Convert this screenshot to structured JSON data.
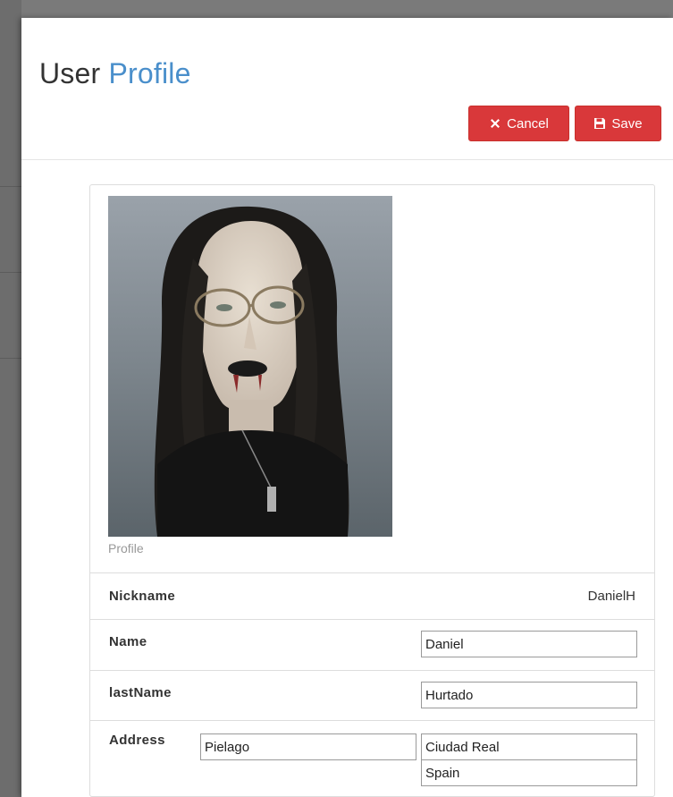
{
  "modal": {
    "title_plain": "User",
    "title_accent": "Profile"
  },
  "toolbar": {
    "cancel_label": "Cancel",
    "save_label": "Save"
  },
  "colors": {
    "title_accent": "#4a8fcb",
    "button_danger": "#d9383a"
  },
  "icons": {
    "cancel": "close-icon",
    "save": "floppy-disk-icon"
  },
  "profile": {
    "photo_caption": "Profile",
    "nickname_label": "Nickname",
    "nickname_value": "DanielH",
    "name_label": "Name",
    "name_value": "Daniel",
    "lastname_label": "lastName",
    "lastname_value": "Hurtado",
    "address_label": "Address",
    "address_street": "Pielago",
    "address_city": "Ciudad Real",
    "address_country": "Spain"
  }
}
